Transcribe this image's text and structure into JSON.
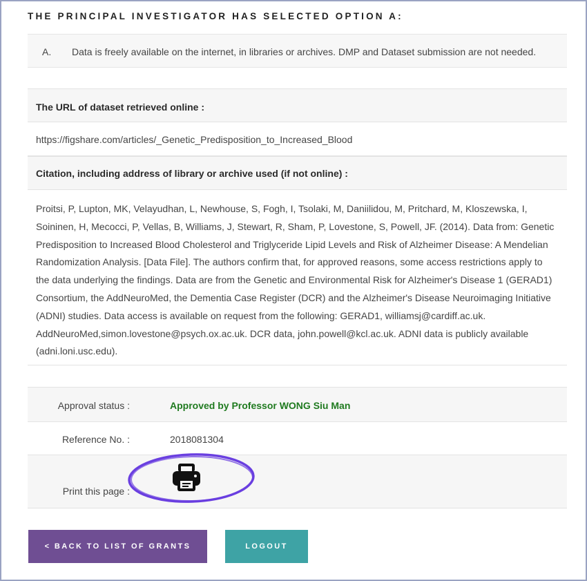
{
  "heading": "THE PRINCIPAL INVESTIGATOR HAS SELECTED OPTION A:",
  "option": {
    "letter": "A.",
    "text": "Data is freely available on the internet, in libraries or archives. DMP and Dataset submission are not needed."
  },
  "dataset": {
    "url_label": "The URL of dataset retrieved online :",
    "url_value": "https://figshare.com/articles/_Genetic_Predisposition_to_Increased_Blood",
    "citation_label": "Citation, including address of library or archive used (if not online) :",
    "citation_value": "Proitsi, P, Lupton, MK, Velayudhan, L, Newhouse, S, Fogh, I, Tsolaki, M, Daniilidou, M, Pritchard, M, Kloszewska, I, Soininen, H, Mecocci, P, Vellas, B, Williams, J, Stewart, R, Sham, P, Lovestone, S, Powell, JF. (2014). Data from: Genetic Predisposition to Increased Blood Cholesterol and Triglyceride Lipid Levels and Risk of Alzheimer Disease: A Mendelian Randomization Analysis. [Data File]. The authors confirm that, for approved reasons, some access restrictions apply to the data underlying the findings. Data are from the Genetic and Environmental Risk for Alzheimer's Disease 1 (GERAD1) Consortium, the AddNeuroMed, the Dementia Case Register (DCR) and the Alzheimer's Disease Neuroimaging Initiative (ADNI) studies. Data access is available on request from the following: GERAD1, williamsj@cardiff.ac.uk. AddNeuroMed,simon.lovestone@psych.ox.ac.uk. DCR data, john.powell@kcl.ac.uk. ADNI data is publicly available (adni.loni.usc.edu)."
  },
  "status": {
    "approval_label": "Approval status :",
    "approval_value": "Approved by Professor WONG Siu Man",
    "approval_color": "#1f7a1f",
    "reference_label": "Reference No. :",
    "reference_value": "2018081304",
    "print_label": "Print this page :",
    "print_icon": "printer-icon",
    "highlight_color": "#6a3fe0"
  },
  "buttons": {
    "back_label": "< BACK TO LIST OF GRANTS",
    "back_color": "#6f4e93",
    "logout_label": "LOGOUT",
    "logout_color": "#3ea3a5"
  }
}
